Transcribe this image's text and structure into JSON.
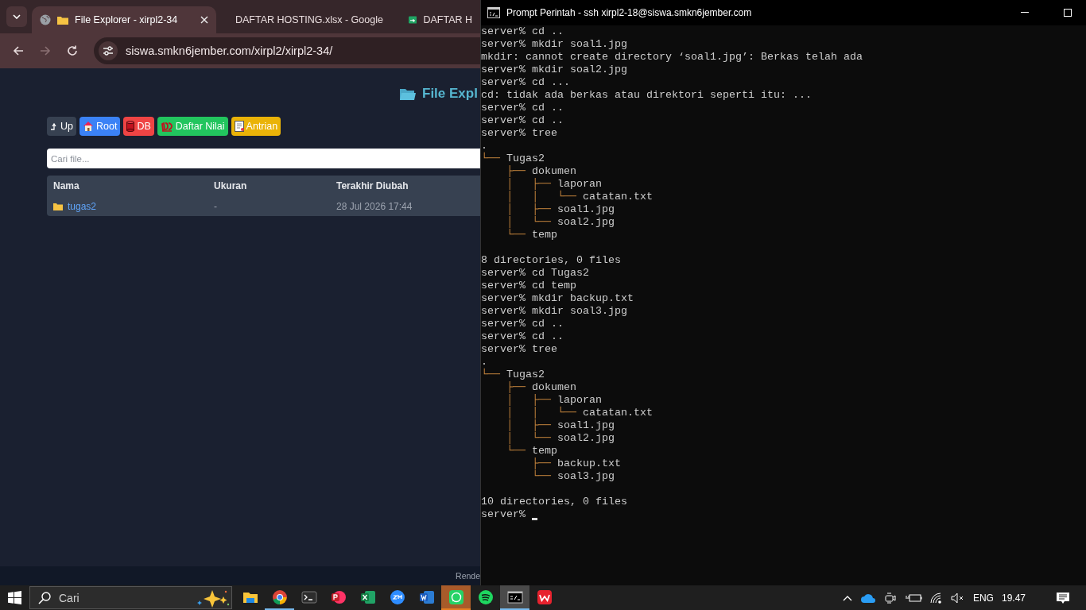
{
  "browser": {
    "tabs": [
      {
        "title": "File Explorer - xirpl2-34",
        "selected": true
      },
      {
        "title": "DAFTAR HOSTING.xlsx - Google",
        "selected": false
      },
      {
        "title": "DAFTAR H",
        "selected": false
      }
    ],
    "forward_disabled": true,
    "url": "siswa.smkn6jember.com/xirpl2/xirpl2-34/",
    "page": {
      "title": "File Expl",
      "buttons": [
        {
          "label": "Up",
          "color": "#374151"
        },
        {
          "label": "Root",
          "color": "#3b82f6"
        },
        {
          "label": "DB",
          "color": "#ef4444"
        },
        {
          "label": "Daftar Nilai",
          "color": "#22c55e"
        },
        {
          "label": "Antrian",
          "color": "#eab308"
        }
      ],
      "search": {
        "placeholder": "Cari file..."
      },
      "table": {
        "columns": [
          "Nama",
          "Ukuran",
          "Terakhir Diubah"
        ],
        "rows": [
          {
            "kind": "folder",
            "cells": [
              "tugas2",
              "-",
              "28 Jul 2026 17:44"
            ]
          }
        ]
      },
      "footer": "Rende"
    }
  },
  "terminal": {
    "title": "Prompt Perintah - ssh  xirpl2-18@siswa.smkn6jember.com",
    "lines": [
      {
        "kind": "text",
        "text": "server% cd .."
      },
      {
        "kind": "text",
        "text": "server% mkdir soal1.jpg"
      },
      {
        "kind": "text",
        "text": "mkdir: cannot create directory ‘soal1.jpg’: Berkas telah ada"
      },
      {
        "kind": "text",
        "text": "server% mkdir soal2.jpg"
      },
      {
        "kind": "text",
        "text": "server% cd ..."
      },
      {
        "kind": "text",
        "text": "cd: tidak ada berkas atau direktori seperti itu: ..."
      },
      {
        "kind": "text",
        "text": "server% cd .."
      },
      {
        "kind": "text",
        "text": "server% cd .."
      },
      {
        "kind": "text",
        "text": "server% tree"
      },
      {
        "kind": "text",
        "text": "."
      },
      {
        "kind": "tree",
        "branch": "└── ",
        "name": "Tugas2"
      },
      {
        "kind": "tree",
        "branch": "    ├── ",
        "name": "dokumen"
      },
      {
        "kind": "tree",
        "branch": "    │   ├── ",
        "name": "laporan"
      },
      {
        "kind": "tree",
        "branch": "    │   │   └── ",
        "name": "catatan.txt"
      },
      {
        "kind": "tree",
        "branch": "    │   ├── ",
        "name": "soal1.jpg"
      },
      {
        "kind": "tree",
        "branch": "    │   └── ",
        "name": "soal2.jpg"
      },
      {
        "kind": "tree",
        "branch": "    └── ",
        "name": "temp"
      },
      {
        "kind": "blank"
      },
      {
        "kind": "text",
        "text": "8 directories, 0 files"
      },
      {
        "kind": "text",
        "text": "server% cd Tugas2"
      },
      {
        "kind": "text",
        "text": "server% cd temp"
      },
      {
        "kind": "text",
        "text": "server% mkdir backup.txt"
      },
      {
        "kind": "text",
        "text": "server% mkdir soal3.jpg"
      },
      {
        "kind": "text",
        "text": "server% cd .."
      },
      {
        "kind": "text",
        "text": "server% cd .."
      },
      {
        "kind": "text",
        "text": "server% tree"
      },
      {
        "kind": "text",
        "text": "."
      },
      {
        "kind": "tree",
        "branch": "└── ",
        "name": "Tugas2"
      },
      {
        "kind": "tree",
        "branch": "    ├── ",
        "name": "dokumen"
      },
      {
        "kind": "tree",
        "branch": "    │   ├── ",
        "name": "laporan"
      },
      {
        "kind": "tree",
        "branch": "    │   │   └── ",
        "name": "catatan.txt"
      },
      {
        "kind": "tree",
        "branch": "    │   ├── ",
        "name": "soal1.jpg"
      },
      {
        "kind": "tree",
        "branch": "    │   └── ",
        "name": "soal2.jpg"
      },
      {
        "kind": "tree",
        "branch": "    └── ",
        "name": "temp"
      },
      {
        "kind": "tree",
        "branch": "        ├── ",
        "name": "backup.txt"
      },
      {
        "kind": "tree",
        "branch": "        └── ",
        "name": "soal3.jpg"
      },
      {
        "kind": "blank"
      },
      {
        "kind": "text",
        "text": "10 directories, 0 files"
      },
      {
        "kind": "prompt",
        "text": "server%",
        "cursor": true
      }
    ]
  },
  "taskbar": {
    "search": {
      "placeholder": "Cari"
    },
    "apps": [
      {
        "kind": "files",
        "running": false,
        "selected": false,
        "flashing": false
      },
      {
        "kind": "chrome",
        "running": true,
        "selected": false,
        "flashing": false
      },
      {
        "kind": "terminal",
        "running": false,
        "selected": false,
        "flashing": false
      },
      {
        "kind": "powerpoint",
        "running": false,
        "selected": false,
        "flashing": false
      },
      {
        "kind": "excel",
        "running": false,
        "selected": false,
        "flashing": false
      },
      {
        "kind": "zoom",
        "running": false,
        "selected": false,
        "flashing": false
      },
      {
        "kind": "word",
        "running": false,
        "selected": false,
        "flashing": false
      },
      {
        "kind": "whatsapp",
        "running": true,
        "selected": false,
        "flashing": true
      },
      {
        "kind": "spotify",
        "running": false,
        "selected": false,
        "flashing": false
      },
      {
        "kind": "cmd",
        "running": true,
        "selected": true,
        "flashing": false
      },
      {
        "kind": "wps",
        "running": false,
        "selected": false,
        "flashing": false
      }
    ],
    "language": "ENG",
    "time": "19.47"
  }
}
